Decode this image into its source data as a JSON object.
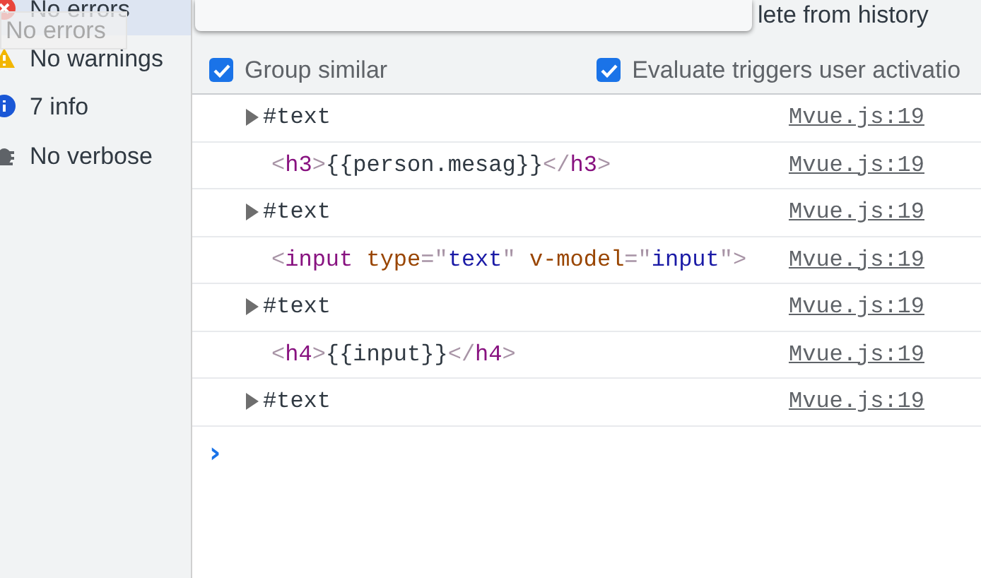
{
  "sidebar": {
    "items": [
      {
        "kind": "error",
        "label": "No errors",
        "selected": true
      },
      {
        "kind": "warning",
        "label": "No warnings",
        "selected": false
      },
      {
        "kind": "info",
        "label": "7 info",
        "selected": false
      },
      {
        "kind": "verbose",
        "label": "No verbose",
        "selected": false
      }
    ],
    "drag_ghost": {
      "label": "No errors"
    }
  },
  "menu_hint": "lete from history",
  "toolbar": {
    "options": [
      {
        "label": "Group similar",
        "checked": true
      },
      {
        "label": "Evaluate triggers user activatio",
        "checked": true
      }
    ]
  },
  "console": {
    "rows": [
      {
        "kind": "node",
        "expanded": false,
        "tokens": [
          {
            "kind": "text",
            "text": "#text"
          }
        ],
        "source": "Mvue.js:19"
      },
      {
        "kind": "element",
        "tokens": [
          {
            "kind": "bracket",
            "text": "<"
          },
          {
            "kind": "tag",
            "text": "h3"
          },
          {
            "kind": "bracket",
            "text": ">"
          },
          {
            "kind": "text",
            "text": "{{person.mesag}}"
          },
          {
            "kind": "bracket",
            "text": "</"
          },
          {
            "kind": "tag",
            "text": "h3"
          },
          {
            "kind": "bracket",
            "text": ">"
          }
        ],
        "source": "Mvue.js:19"
      },
      {
        "kind": "node",
        "expanded": false,
        "tokens": [
          {
            "kind": "text",
            "text": "#text"
          }
        ],
        "source": "Mvue.js:19"
      },
      {
        "kind": "element",
        "tokens": [
          {
            "kind": "bracket",
            "text": "<"
          },
          {
            "kind": "tag",
            "text": "input"
          },
          {
            "kind": "attr",
            "text": " type"
          },
          {
            "kind": "bracket",
            "text": "=\""
          },
          {
            "kind": "value",
            "text": "text"
          },
          {
            "kind": "bracket",
            "text": "\""
          },
          {
            "kind": "attr",
            "text": " v-model"
          },
          {
            "kind": "bracket",
            "text": "=\""
          },
          {
            "kind": "value",
            "text": "input"
          },
          {
            "kind": "bracket",
            "text": "\">"
          }
        ],
        "source": "Mvue.js:19"
      },
      {
        "kind": "node",
        "expanded": false,
        "tokens": [
          {
            "kind": "text",
            "text": "#text"
          }
        ],
        "source": "Mvue.js:19"
      },
      {
        "kind": "element",
        "tokens": [
          {
            "kind": "bracket",
            "text": "<"
          },
          {
            "kind": "tag",
            "text": "h4"
          },
          {
            "kind": "bracket",
            "text": ">"
          },
          {
            "kind": "text",
            "text": "{{input}}"
          },
          {
            "kind": "bracket",
            "text": "</"
          },
          {
            "kind": "tag",
            "text": "h4"
          },
          {
            "kind": "bracket",
            "text": ">"
          }
        ],
        "source": "Mvue.js:19"
      },
      {
        "kind": "node",
        "expanded": false,
        "tokens": [
          {
            "kind": "text",
            "text": "#text"
          }
        ],
        "source": "Mvue.js:19"
      }
    ],
    "prompt": "›"
  }
}
